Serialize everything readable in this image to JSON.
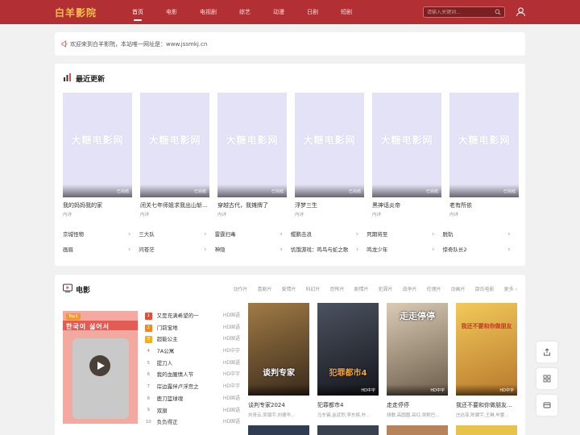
{
  "header": {
    "logo": "白羊影院",
    "nav": [
      "首页",
      "电影",
      "电视剧",
      "综艺",
      "动漫",
      "日剧",
      "短剧"
    ],
    "search_placeholder": "请输入关键词..."
  },
  "notice": {
    "text": "欢迎来到白羊影院，本站唯一网址是：www.jssmkj.cn"
  },
  "recent": {
    "title": "最近更新",
    "watermark": "大糖电影网",
    "cards": [
      {
        "name": "我的妈妈我的家",
        "status": "已完结",
        "sub": "内详"
      },
      {
        "name": "闭关七年师姐求我出山斩...",
        "status": "已完结",
        "sub": "内详"
      },
      {
        "name": "穿越古代，我摊牌了",
        "status": "已完结",
        "sub": "内详"
      },
      {
        "name": "浮梦三生",
        "status": "已完结",
        "sub": "内详"
      },
      {
        "name": "黑神话炎帝",
        "status": "已完结",
        "sub": "内详"
      },
      {
        "name": "老有所依",
        "status": "已完结",
        "sub": "内详"
      }
    ],
    "links": [
      "京城怪物",
      "三大队",
      "雷霆扫毒",
      "鲲鹏击浪",
      "死期将至",
      "脱轨",
      "画眉",
      "问苍茫",
      "神隐",
      "饥饿游戏：鸣鸟与蛇之歌",
      "鸣龙少年",
      "惊奇队长2"
    ]
  },
  "movies": {
    "title": "电影",
    "categories": [
      "动作片",
      "喜剧片",
      "爱情片",
      "科幻片",
      "恐怖片",
      "剧情片",
      "犯罪片",
      "战争片",
      "伦理片",
      "动画片",
      "邵氏电影",
      "更多"
    ],
    "feature": {
      "tag": "Top1",
      "text": "한국이 싫어서"
    },
    "ranking": [
      {
        "num": "1",
        "title": "又是充满希望的一",
        "quality": "HD国语"
      },
      {
        "num": "2",
        "title": "门前宝地",
        "quality": "HD国语"
      },
      {
        "num": "3",
        "title": "超能公主",
        "quality": "HD国语"
      },
      {
        "num": "4",
        "title": "7A公寓",
        "quality": "HD中字"
      },
      {
        "num": "5",
        "title": "提刀人",
        "quality": "HD国语"
      },
      {
        "num": "6",
        "title": "我的血腥情人节",
        "quality": "HD中字"
      },
      {
        "num": "7",
        "title": "岸边露伴卢浮宫之",
        "quality": "HD中字"
      },
      {
        "num": "8",
        "title": "鹿刀篮球魂",
        "quality": "HD国语"
      },
      {
        "num": "9",
        "title": "双旗",
        "quality": "HD国语"
      },
      {
        "num": "10",
        "title": "负负得正",
        "quality": "HD国语"
      }
    ],
    "cards": [
      {
        "name": "谈判专家2024",
        "sub": "刘青云,吴镇宇,刘德华,..",
        "quality": "",
        "poster_text": "谈判专家",
        "color": "#6b4a2a"
      },
      {
        "name": "犯罪都市4",
        "sub": "马东锡,金武烈,李东辉,朴...",
        "quality": "HD中字",
        "poster_text": "犯罪都市4",
        "color": "#2c2f36"
      },
      {
        "name": "走走停停",
        "sub": "胡歌,高圆圆,岳红,吴默巴...",
        "quality": "HD中字",
        "poster_text": "走走停停",
        "color": "#9b8b75"
      },
      {
        "name": "我还不要和你做朋友...",
        "sub": "庄达菲,陈翼宇,王琳,毕雯...",
        "quality": "HD中字",
        "poster_text": "我还不要和你做朋友",
        "color": "#d9a53a"
      }
    ]
  }
}
